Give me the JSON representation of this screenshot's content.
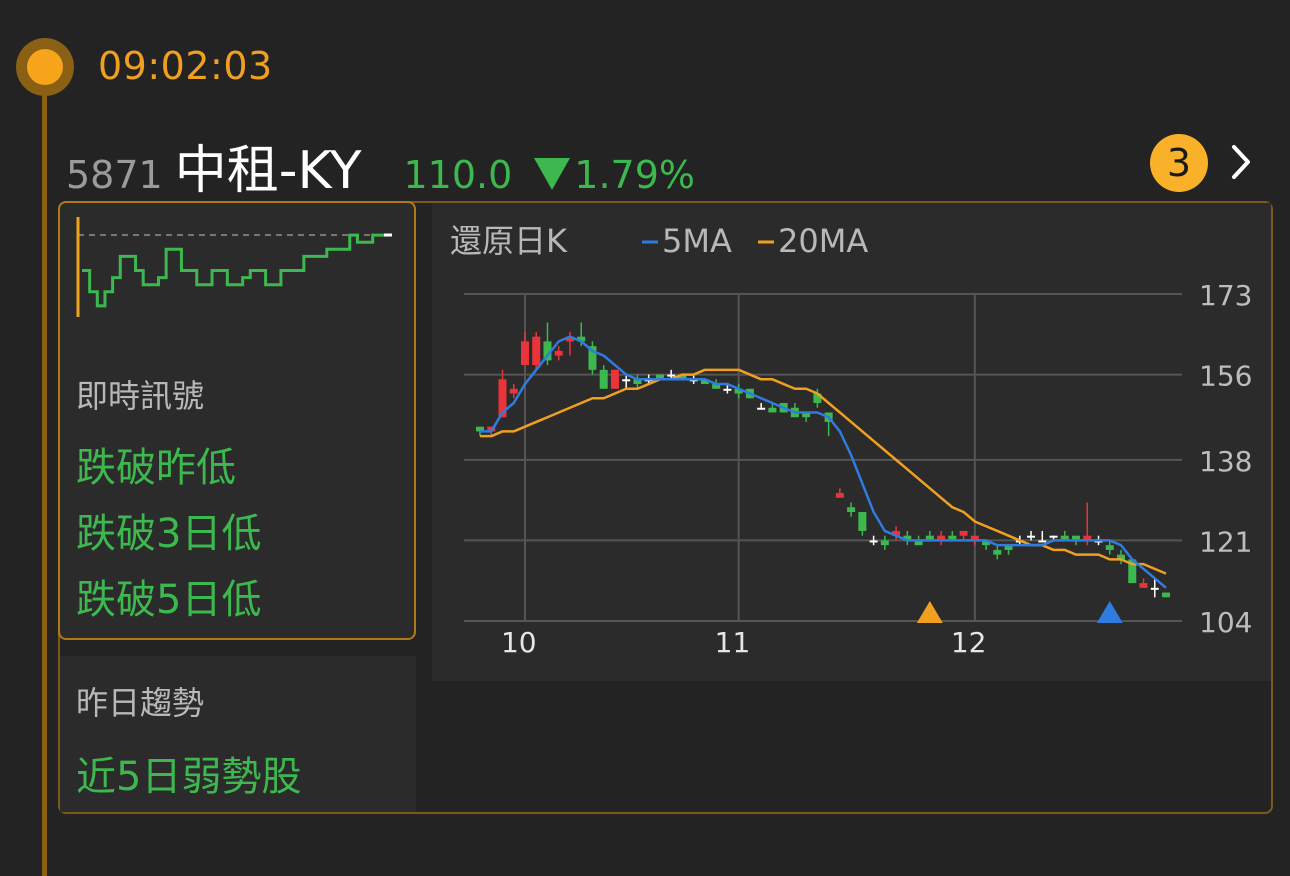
{
  "timeline": {
    "time": "09:02:03"
  },
  "stock": {
    "code": "5871",
    "name": "中租-KY",
    "price": "110.0",
    "change": "1.79%",
    "direction": "down",
    "up_color": "#e8343a",
    "down_color": "#3cb84f"
  },
  "header": {
    "badge_count": "3",
    "more_icon": "chevron-right-icon"
  },
  "signals": {
    "title": "即時訊號",
    "items": [
      "跌破昨低",
      "跌破3日低",
      "跌破5日低"
    ]
  },
  "trend": {
    "title": "昨日趨勢",
    "value": "近5日弱勢股"
  },
  "intraday_chart": {
    "type": "line",
    "reference": 112.0,
    "values": [
      111.0,
      110.4,
      110.0,
      110.4,
      110.8,
      111.4,
      111.4,
      111.0,
      110.6,
      110.6,
      110.8,
      111.6,
      111.6,
      111.0,
      111.0,
      110.6,
      110.6,
      111.0,
      111.0,
      110.6,
      110.6,
      110.8,
      111.0,
      111.0,
      110.6,
      110.6,
      111.0,
      111.0,
      111.0,
      111.4,
      111.4,
      111.4,
      111.6,
      111.6,
      111.6,
      112.0,
      111.8,
      111.8,
      112.0,
      112.0,
      112.0
    ]
  },
  "chart_data": {
    "type": "candlestick",
    "title": "還原日K",
    "legend": [
      {
        "name": "5MA",
        "color": "#2f7be0"
      },
      {
        "name": "20MA",
        "color": "#f0a020"
      }
    ],
    "y_ticks": [
      173,
      156,
      138,
      121,
      104
    ],
    "ylim": [
      104,
      173
    ],
    "x_ticks": [
      {
        "label": "10",
        "index": 4
      },
      {
        "label": "11",
        "index": 23
      },
      {
        "label": "12",
        "index": 44
      }
    ],
    "candles": [
      [
        145,
        145,
        143,
        144
      ],
      [
        144,
        145,
        143,
        145
      ],
      [
        147,
        157,
        147,
        155
      ],
      [
        152,
        154,
        151,
        153
      ],
      [
        158,
        165,
        158,
        163
      ],
      [
        158,
        165,
        157,
        164
      ],
      [
        163,
        167,
        158,
        159
      ],
      [
        160,
        162,
        159,
        161
      ],
      [
        163,
        165,
        160,
        164
      ],
      [
        164,
        167,
        162,
        163
      ],
      [
        162,
        163,
        156,
        157
      ],
      [
        157,
        158,
        153,
        153
      ],
      [
        153,
        157,
        153,
        157
      ],
      [
        155,
        156,
        153,
        155
      ],
      [
        155,
        156,
        153,
        154
      ],
      [
        155,
        156,
        154,
        155
      ],
      [
        156,
        156,
        155,
        155
      ],
      [
        156,
        157,
        155,
        156
      ],
      [
        156,
        156,
        155,
        155
      ],
      [
        155,
        156,
        154,
        155
      ],
      [
        155,
        155,
        154,
        154
      ],
      [
        154,
        155,
        153,
        153
      ],
      [
        153,
        154,
        152,
        153
      ],
      [
        153,
        154,
        151,
        152
      ],
      [
        153,
        153,
        151,
        151
      ],
      [
        149,
        150,
        149,
        149
      ],
      [
        149,
        150,
        148,
        148
      ],
      [
        150,
        150,
        148,
        148
      ],
      [
        149,
        150,
        148,
        147
      ],
      [
        148,
        148,
        146,
        147
      ],
      [
        152,
        153,
        149,
        150
      ],
      [
        148,
        148,
        143,
        146
      ],
      [
        130,
        132,
        130,
        131
      ],
      [
        128,
        129,
        126,
        127
      ],
      [
        127,
        127,
        122,
        123
      ],
      [
        121,
        122,
        120,
        121
      ],
      [
        121,
        122,
        119,
        120
      ],
      [
        122,
        124,
        121,
        123
      ],
      [
        122,
        123,
        120,
        121
      ],
      [
        121,
        122,
        120,
        120
      ],
      [
        122,
        123,
        121,
        121
      ],
      [
        121,
        123,
        120,
        122
      ],
      [
        122,
        123,
        121,
        121
      ],
      [
        122,
        123,
        121,
        123
      ],
      [
        121,
        122,
        120,
        122
      ],
      [
        121,
        121,
        119,
        120
      ],
      [
        119,
        120,
        117,
        118
      ],
      [
        120,
        120,
        118,
        119
      ],
      [
        121,
        122,
        120,
        121
      ],
      [
        122,
        123,
        121,
        122
      ],
      [
        121,
        123,
        121,
        121
      ],
      [
        122,
        122,
        121,
        122
      ],
      [
        122,
        123,
        121,
        121
      ],
      [
        122,
        122,
        120,
        121
      ],
      [
        121,
        129,
        120,
        122
      ],
      [
        121,
        122,
        120,
        121
      ],
      [
        120,
        121,
        118,
        119
      ],
      [
        118,
        119,
        116,
        117
      ],
      [
        117,
        117,
        112,
        112
      ],
      [
        111,
        113,
        111,
        112
      ],
      [
        111,
        113,
        109,
        111
      ],
      [
        110,
        110,
        109,
        109
      ]
    ],
    "ma5": [
      144,
      144,
      148,
      150,
      154,
      157,
      160,
      163,
      164,
      163,
      161,
      160,
      158,
      156,
      155,
      155,
      155,
      155,
      155,
      155,
      155,
      154,
      154,
      153,
      152,
      151,
      150,
      149,
      148,
      148,
      148,
      147,
      144,
      139,
      133,
      127,
      123,
      122,
      121,
      121,
      121,
      121,
      121,
      121,
      121,
      121,
      120,
      120,
      120,
      120,
      120,
      121,
      121,
      121,
      121,
      121,
      121,
      120,
      117,
      115,
      113,
      111
    ],
    "ma20": [
      143,
      143,
      144,
      144,
      145,
      146,
      147,
      148,
      149,
      150,
      151,
      151,
      152,
      153,
      153,
      154,
      155,
      155,
      156,
      156,
      157,
      157,
      157,
      157,
      156,
      155,
      155,
      154,
      153,
      153,
      152,
      150,
      148,
      146,
      144,
      142,
      140,
      138,
      136,
      134,
      132,
      130,
      128,
      127,
      125,
      124,
      123,
      122,
      121,
      120,
      120,
      119,
      119,
      118,
      118,
      118,
      117,
      117,
      116,
      116,
      115,
      114
    ],
    "markers": [
      {
        "index": 40,
        "color": "#f0a020"
      },
      {
        "index": 56,
        "color": "#2f7be0"
      }
    ],
    "grid": true
  }
}
